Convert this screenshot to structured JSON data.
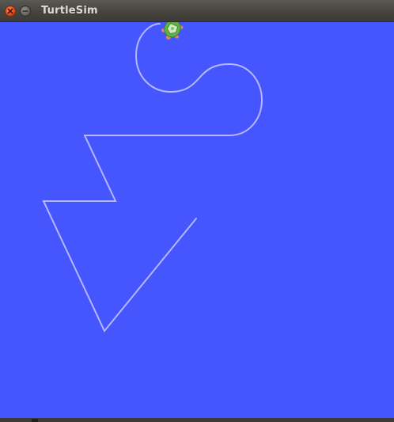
{
  "window": {
    "title": "TurtleSim"
  },
  "icons": {
    "close": "close-icon",
    "minimize": "minimize-icon",
    "turtle": "turtle-icon"
  },
  "colors": {
    "background": "#4556ff",
    "pen": "#b3b8ff",
    "titlebar": "#3c3b37",
    "title_text": "#dfdbd2",
    "close_button": "#e0491e",
    "turtle_shell": "#5fb34a"
  }
}
